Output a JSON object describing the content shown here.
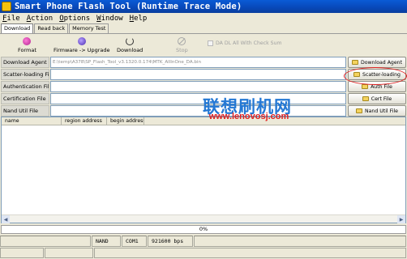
{
  "window": {
    "title": "Smart Phone Flash Tool (Runtime Trace Mode)"
  },
  "menu": [
    {
      "label": "File",
      "u": "F",
      "rest": "ile"
    },
    {
      "label": "Action",
      "u": "A",
      "rest": "ction"
    },
    {
      "label": "Options",
      "u": "O",
      "rest": "ptions"
    },
    {
      "label": "Window",
      "u": "W",
      "rest": "indow"
    },
    {
      "label": "Help",
      "u": "H",
      "rest": "elp"
    }
  ],
  "tabs": [
    "Download",
    "Read back",
    "Memory Test"
  ],
  "toolbar": {
    "format": "Format",
    "upgrade": "Firmware -> Upgrade",
    "download": "Download",
    "stop": "Stop",
    "checksum": "DA DL All With Check Sum"
  },
  "rows": {
    "download_agent": {
      "label": "Download Agent",
      "value": "E:\\temp\\A378\\SP_Flash_Tool_v3.1320.0.174\\MTK_AllInOne_DA.bin",
      "button": "Download Agent"
    },
    "scatter": {
      "label": "Scatter-loading File",
      "value": "",
      "button": "Scatter-loading"
    },
    "auth": {
      "label": "Authentication File",
      "value": "",
      "button": "Auth File"
    },
    "cert": {
      "label": "Certification File",
      "value": "",
      "button": "Cert File"
    },
    "nand": {
      "label": "Nand Util File",
      "value": "",
      "button": "Nand Util File"
    }
  },
  "list": {
    "columns": [
      "name",
      "region address",
      "begin address"
    ]
  },
  "watermark": {
    "text": "联想刷机网",
    "url": "www.lenovosj.com"
  },
  "progress": {
    "value": 0,
    "label": "0%",
    "color": "#2d64c8"
  },
  "status": {
    "storage": "NAND",
    "port": "COM1",
    "baud": "921600 bps"
  },
  "colors": {
    "titlebar": "#0848b8",
    "annotation": "#e02020"
  }
}
